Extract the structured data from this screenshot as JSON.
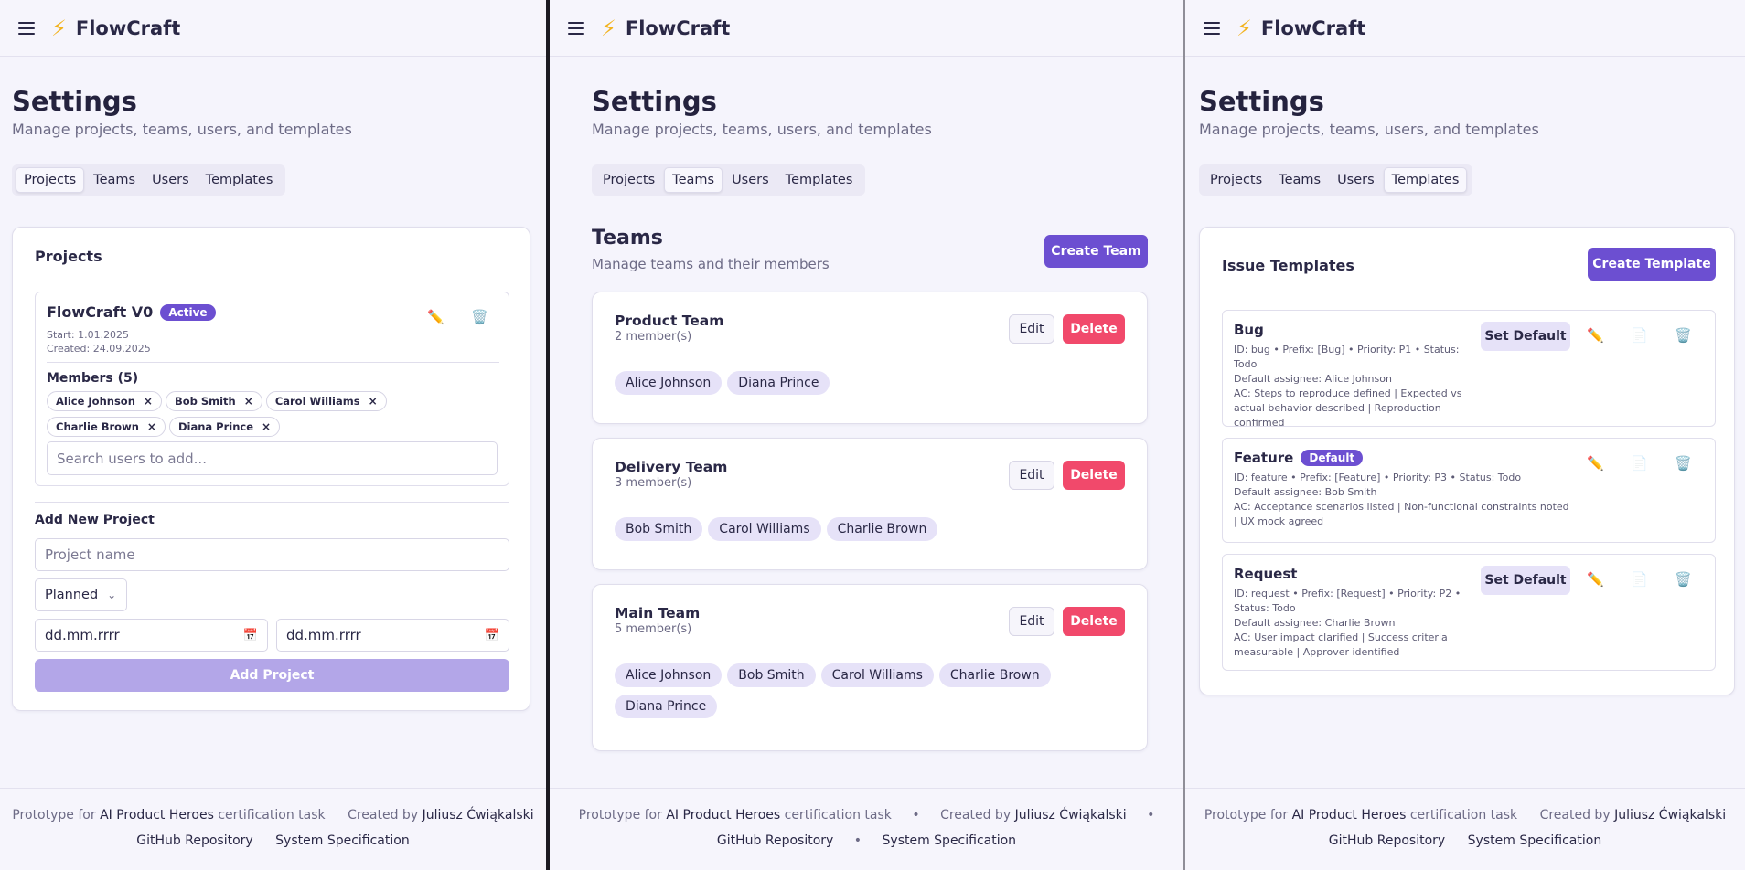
{
  "app": {
    "brand": "FlowCraft",
    "brand_icon": "⚡",
    "accent": "#6c4fd1"
  },
  "settings": {
    "title": "Settings",
    "subtitle": "Manage projects, teams, users, and templates",
    "tabs": [
      "Projects",
      "Teams",
      "Users",
      "Templates"
    ]
  },
  "projects": {
    "heading": "Projects",
    "project": {
      "name": "FlowCraft V0",
      "status": "Active",
      "start": "Start: 1.01.2025",
      "created": "Created: 24.09.2025",
      "members_label": "Members (5)",
      "members": [
        "Alice Johnson",
        "Bob Smith",
        "Carol Williams",
        "Charlie Brown",
        "Diana Prince"
      ],
      "search_placeholder": "Search users to add..."
    },
    "add_new": {
      "label": "Add New Project",
      "name_placeholder": "Project name",
      "status_value": "Planned",
      "date_placeholder": "dd.mm.rrrr",
      "button": "Add Project"
    }
  },
  "teams": {
    "title": "Teams",
    "subtitle": "Manage teams and their members",
    "create_button": "Create Team",
    "edit_label": "Edit",
    "delete_label": "Delete",
    "list": [
      {
        "name": "Product Team",
        "count": "2 member(s)",
        "members": [
          "Alice Johnson",
          "Diana Prince"
        ]
      },
      {
        "name": "Delivery Team",
        "count": "3 member(s)",
        "members": [
          "Bob Smith",
          "Carol Williams",
          "Charlie Brown"
        ]
      },
      {
        "name": "Main Team",
        "count": "5 member(s)",
        "members": [
          "Alice Johnson",
          "Bob Smith",
          "Carol Williams",
          "Charlie Brown",
          "Diana Prince"
        ]
      }
    ]
  },
  "templates": {
    "title": "Issue Templates",
    "create_button": "Create Template",
    "set_default_label": "Set Default",
    "default_badge": "Default",
    "list": [
      {
        "name": "Bug",
        "line1": "ID: bug • Prefix: [Bug] • Priority: P1 • Status: Todo",
        "line2": "Default assignee: Alice Johnson",
        "line3": "AC: Steps to reproduce defined | Expected vs actual behavior described | Reproduction confirmed"
      },
      {
        "name": "Feature",
        "line1": "ID: feature • Prefix: [Feature] • Priority: P3 • Status: Todo",
        "line2": "Default assignee: Bob Smith",
        "line3": "AC: Acceptance scenarios listed | Non-functional constraints noted | UX mock agreed"
      },
      {
        "name": "Request",
        "line1": "ID: request • Prefix: [Request] • Priority: P2 • Status: Todo",
        "line2": "Default assignee: Charlie Brown",
        "line3": "AC: User impact clarified | Success criteria measurable | Approver identified"
      }
    ]
  },
  "footer": {
    "prototype_prefix": "Prototype for",
    "prototype_name": "AI Product Heroes",
    "prototype_suffix": "certification task",
    "created_prefix": "Created by",
    "author": "Juliusz Ćwiąkalski",
    "separator": "•",
    "github": "GitHub Repository",
    "spec": "System Specification"
  }
}
